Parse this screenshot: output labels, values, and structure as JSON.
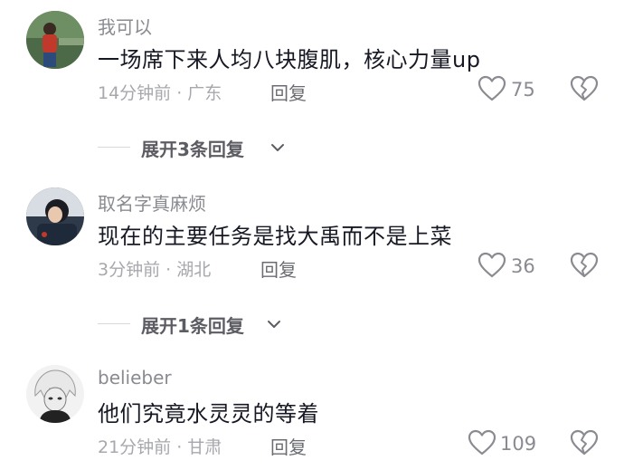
{
  "comments": [
    {
      "username": "我可以",
      "text": "一场席下来人均八块腹肌，核心力量up",
      "meta": "14分钟前 · 广东",
      "reply_label": "回复",
      "likes": "75",
      "expand_label": "展开3条回复"
    },
    {
      "username": "取名字真麻烦",
      "text": "现在的主要任务是找大禹而不是上菜",
      "meta": "3分钟前 · 湖北",
      "reply_label": "回复",
      "likes": "36",
      "expand_label": "展开1条回复"
    },
    {
      "username": "belieber",
      "text": "他们究竟水灵灵的等着",
      "meta": "21分钟前 · 甘肃",
      "reply_label": "回复",
      "likes": "109"
    }
  ],
  "icons": {
    "like": "heart-outline-icon",
    "dislike": "broken-heart-icon",
    "expand": "chevron-down-icon"
  },
  "colors": {
    "text_primary": "#161823",
    "text_secondary": "#8a8b91",
    "meta": "#a7a8ad",
    "icon": "#8a8b91"
  }
}
